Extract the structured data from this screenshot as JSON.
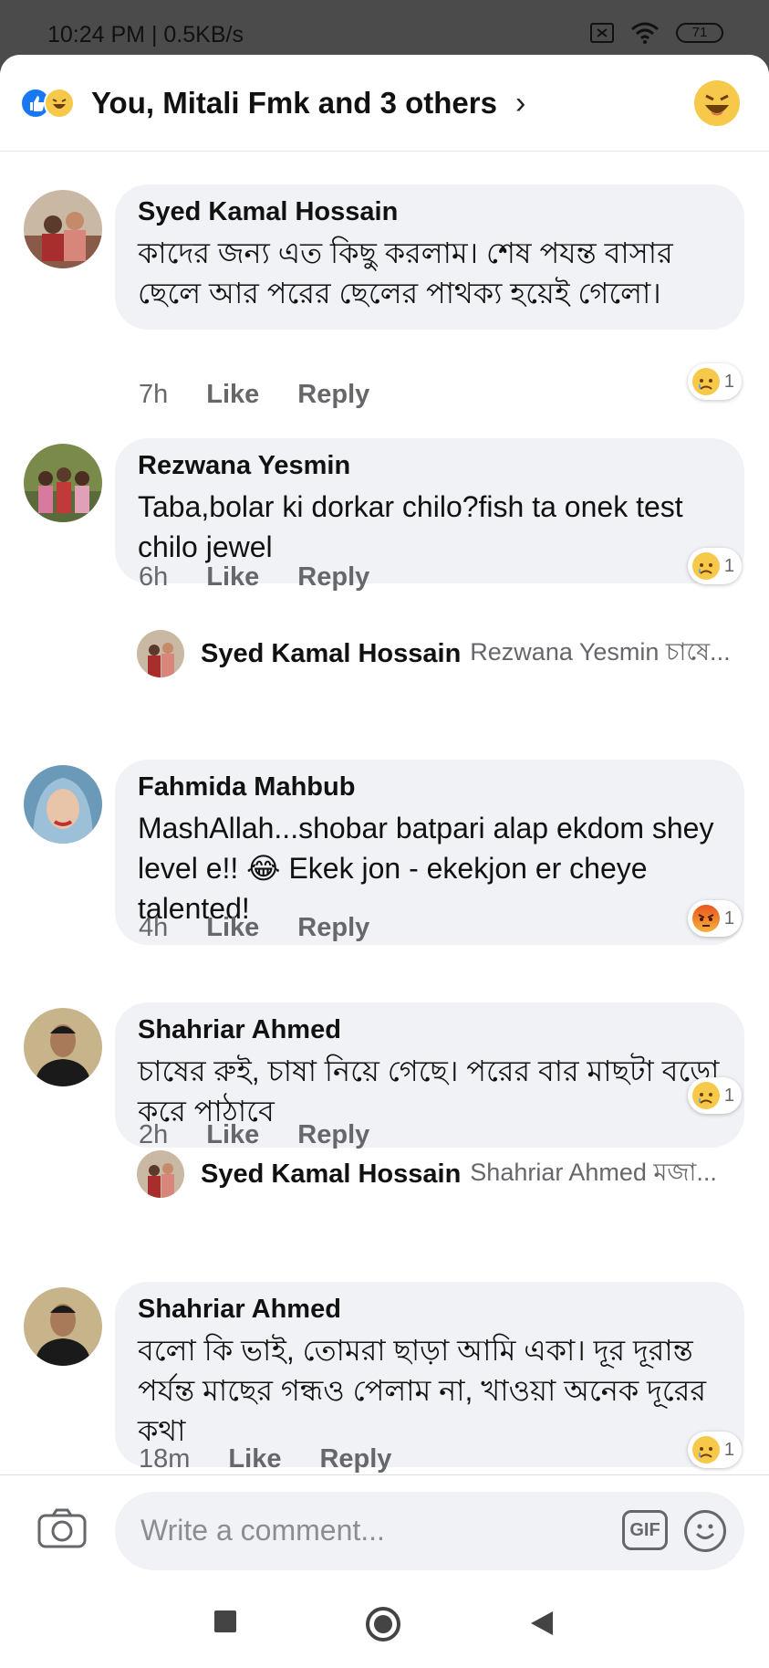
{
  "status": {
    "time": "10:24 PM | 0.5KB/s",
    "battery": "71"
  },
  "header": {
    "title": "You, Mitali Fmk and 3 others"
  },
  "comments": [
    {
      "author": "Syed Kamal Hossain",
      "text": "কাদের জন্য এত কিছু করলাম। শেষ পযন্ত বাসার ছেলে আর পরের ছেলের পাথক্য হয়েই গেলো।",
      "time": "7h",
      "like": "Like",
      "reply": "Reply",
      "react_count": "1",
      "react_icon": "sad-react-icon"
    },
    {
      "author": "Rezwana Yesmin",
      "text": "Taba,bolar ki dorkar chilo?fish ta onek test chilo jewel",
      "time": "6h",
      "like": "Like",
      "reply": "Reply",
      "react_count": "1",
      "react_icon": "sad-react-icon"
    },
    {
      "author": "Fahmida Mahbub",
      "text": "MashAllah...shobar batpari alap ekdom shey level e!! 😂 Ekek jon - ekekjon er cheye talented!",
      "time": "4h",
      "like": "Like",
      "reply": "Reply",
      "react_count": "1",
      "react_icon": "angry-react-icon"
    },
    {
      "author": "Shahriar Ahmed",
      "text": "চাষের রুই, চাষা নিয়ে গেছে। পরের বার মাছটা বড়ো করে পাঠাবে",
      "time": "2h",
      "like": "Like",
      "reply": "Reply",
      "react_count": "1",
      "react_icon": "sad-react-icon"
    },
    {
      "author": "Shahriar Ahmed",
      "text": "বলো কি ভাই, তোমরা ছাড়া আমি একা। দূর দূরান্ত পর্যন্ত মাছের গন্ধও পেলাম না, খাওয়া অনেক দূরের কথা",
      "time": "18m",
      "like": "Like",
      "reply": "Reply",
      "react_count": "1",
      "react_icon": "sad-react-icon"
    }
  ],
  "replies": [
    {
      "author": "Syed Kamal Hossain",
      "preview": "Rezwana Yesmin চাষে..."
    },
    {
      "author": "Syed Kamal Hossain",
      "preview": "Shahriar Ahmed মজা..."
    }
  ],
  "composer": {
    "placeholder": "Write a comment...",
    "gif": "GIF"
  },
  "colors": {
    "like_blue": "#1877f2",
    "haha_yellow": "#f7c94a",
    "bubble_gray": "#f0f2f5",
    "meta_gray": "#65676b"
  }
}
